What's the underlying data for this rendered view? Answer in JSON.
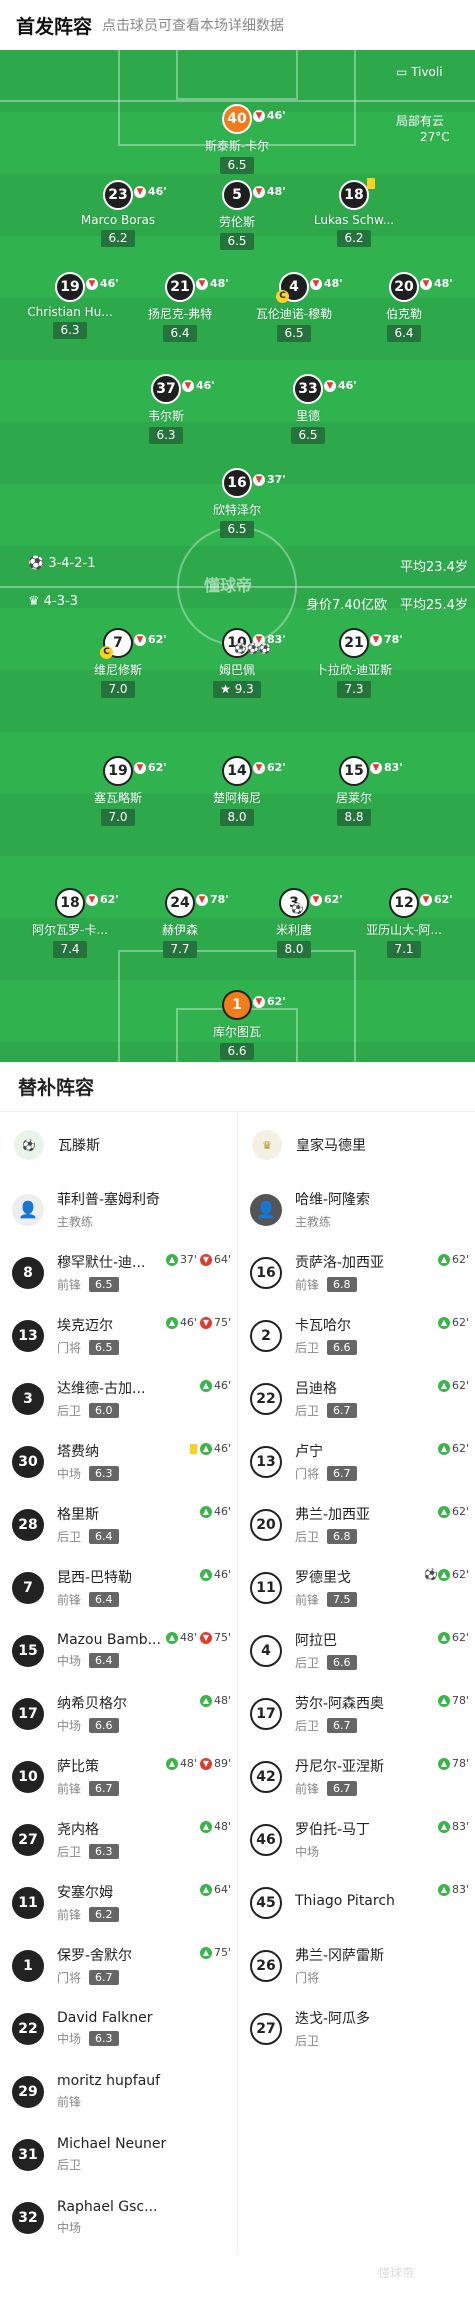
{
  "header": {
    "title": "首发阵容",
    "hint": "点击球员可查看本场详细数据"
  },
  "pitch_info": {
    "venue": "Tivoli",
    "weather": "局部有云",
    "temperature": "27°C",
    "brand_watermark": "懂球帝"
  },
  "home_team": {
    "formation": "3-4-2-1",
    "avg_age": "平均23.4岁"
  },
  "away_team": {
    "formation": "4-3-3",
    "value": "身价7.40亿欧",
    "avg_age": "平均25.4岁"
  },
  "home_players": [
    {
      "num": "40",
      "name": "斯泰斯-卡尔",
      "rating": "6.5",
      "sub": "46'"
    },
    {
      "num": "23",
      "name": "Marco Boras",
      "rating": "6.2",
      "sub": "46'"
    },
    {
      "num": "5",
      "name": "劳伦斯",
      "rating": "6.5",
      "sub": "48'"
    },
    {
      "num": "18",
      "name": "Lukas Schw...",
      "rating": "6.2"
    },
    {
      "num": "19",
      "name": "Christian Hu...",
      "rating": "6.3",
      "sub": "46'"
    },
    {
      "num": "21",
      "name": "扬尼克-弗特",
      "rating": "6.4",
      "sub": "48'"
    },
    {
      "num": "4",
      "name": "瓦伦迪诺-穆勒",
      "rating": "6.5",
      "sub": "48'"
    },
    {
      "num": "20",
      "name": "伯克勒",
      "rating": "6.4",
      "sub": "48'"
    },
    {
      "num": "37",
      "name": "韦尔斯",
      "rating": "6.3",
      "sub": "46'"
    },
    {
      "num": "33",
      "name": "里德",
      "rating": "6.5",
      "sub": "46'"
    },
    {
      "num": "16",
      "name": "欣特泽尔",
      "rating": "6.5",
      "sub": "37'"
    }
  ],
  "away_players": [
    {
      "num": "7",
      "name": "维尼修斯",
      "rating": "7.0",
      "sub": "62'"
    },
    {
      "num": "10",
      "name": "姆巴佩",
      "rating": "9.3",
      "sub": "83'"
    },
    {
      "num": "21",
      "name": "卜拉欣-迪亚斯",
      "rating": "7.3",
      "sub": "78'"
    },
    {
      "num": "19",
      "name": "塞瓦略斯",
      "rating": "7.0",
      "sub": "62'"
    },
    {
      "num": "14",
      "name": "楚阿梅尼",
      "rating": "8.0",
      "sub": "62'"
    },
    {
      "num": "15",
      "name": "居莱尔",
      "rating": "8.8",
      "sub": "83'"
    },
    {
      "num": "18",
      "name": "阿尔瓦罗-卡...",
      "rating": "7.4",
      "sub": "62'"
    },
    {
      "num": "24",
      "name": "赫伊森",
      "rating": "7.7",
      "sub": "78'"
    },
    {
      "num": "3",
      "name": "米利唐",
      "rating": "8.0",
      "sub": "62'"
    },
    {
      "num": "12",
      "name": "亚历山大-阿...",
      "rating": "7.1",
      "sub": "62'"
    },
    {
      "num": "1",
      "name": "库尔图瓦",
      "rating": "6.6",
      "sub": "62'"
    }
  ],
  "subs_section": {
    "title": "替补阵容"
  },
  "subs_home": {
    "team": "瓦滕斯",
    "coach": {
      "name": "菲利普-塞姆利奇",
      "role": "主教练"
    },
    "players": [
      {
        "num": "8",
        "name": "穆罕默仕-迪...",
        "pos": "前锋",
        "rating": "6.5",
        "event": "37'",
        "out": "64'"
      },
      {
        "num": "13",
        "name": "埃克迈尔",
        "pos": "门将",
        "rating": "6.5",
        "event": "46'",
        "out": "75'"
      },
      {
        "num": "3",
        "name": "达维德-古加...",
        "pos": "后卫",
        "rating": "6.0",
        "event": "46'"
      },
      {
        "num": "30",
        "name": "塔费纳",
        "pos": "中场",
        "rating": "6.3",
        "event": "46'"
      },
      {
        "num": "28",
        "name": "格里斯",
        "pos": "后卫",
        "rating": "6.4",
        "event": "46'"
      },
      {
        "num": "7",
        "name": "昆西-巴特勒",
        "pos": "前锋",
        "rating": "6.4",
        "event": "46'"
      },
      {
        "num": "15",
        "name": "Mazou Bamb...",
        "pos": "中场",
        "rating": "6.4",
        "event": "48'",
        "out": "75'"
      },
      {
        "num": "17",
        "name": "纳希贝格尔",
        "pos": "中场",
        "rating": "6.6",
        "event": "48'"
      },
      {
        "num": "10",
        "name": "萨比策",
        "pos": "前锋",
        "rating": "6.7",
        "event": "48'",
        "out": "89'"
      },
      {
        "num": "27",
        "name": "尧内格",
        "pos": "后卫",
        "rating": "6.3",
        "event": "48'"
      },
      {
        "num": "11",
        "name": "安塞尔姆",
        "pos": "前锋",
        "rating": "6.2",
        "event": "64'"
      },
      {
        "num": "1",
        "name": "保罗-舍默尔",
        "pos": "门将",
        "rating": "6.7",
        "event": "75'"
      },
      {
        "num": "22",
        "name": "David Falkner",
        "pos": "中场",
        "rating": "6.3"
      },
      {
        "num": "29",
        "name": "moritz hupfauf",
        "pos": "前锋"
      },
      {
        "num": "31",
        "name": "Michael Neuner",
        "pos": "后卫"
      },
      {
        "num": "32",
        "name": "Raphael Gsc...",
        "pos": "中场"
      }
    ]
  },
  "subs_away": {
    "team": "皇家马德里",
    "coach": {
      "name": "哈维-阿隆索",
      "role": "主教练"
    },
    "players": [
      {
        "num": "16",
        "name": "贡萨洛-加西亚",
        "pos": "前锋",
        "rating": "6.8",
        "event": "62'"
      },
      {
        "num": "2",
        "name": "卡瓦哈尔",
        "pos": "后卫",
        "rating": "6.6",
        "event": "62'"
      },
      {
        "num": "22",
        "name": "吕迪格",
        "pos": "后卫",
        "rating": "6.7",
        "event": "62'"
      },
      {
        "num": "13",
        "name": "卢宁",
        "pos": "门将",
        "rating": "6.7",
        "event": "62'"
      },
      {
        "num": "20",
        "name": "弗兰-加西亚",
        "pos": "后卫",
        "rating": "6.8",
        "event": "62'"
      },
      {
        "num": "11",
        "name": "罗德里戈",
        "pos": "前锋",
        "rating": "7.5",
        "event": "62'"
      },
      {
        "num": "4",
        "name": "阿拉巴",
        "pos": "后卫",
        "rating": "6.6",
        "event": "62'"
      },
      {
        "num": "17",
        "name": "劳尔-阿森西奥",
        "pos": "后卫",
        "rating": "6.7",
        "event": "78'"
      },
      {
        "num": "42",
        "name": "丹尼尔-亚涅斯",
        "pos": "前锋",
        "rating": "6.7",
        "event": "78'"
      },
      {
        "num": "46",
        "name": "罗伯托-马丁",
        "pos": "中场",
        "event": "83'"
      },
      {
        "num": "45",
        "name": "Thiago Pitarch",
        "pos": "",
        "event": "83'"
      },
      {
        "num": "26",
        "name": "弗兰-冈萨雷斯",
        "pos": "门将"
      },
      {
        "num": "27",
        "name": "迭戈-阿瓜多",
        "pos": "后卫"
      }
    ]
  },
  "watermark": "懂球帝"
}
